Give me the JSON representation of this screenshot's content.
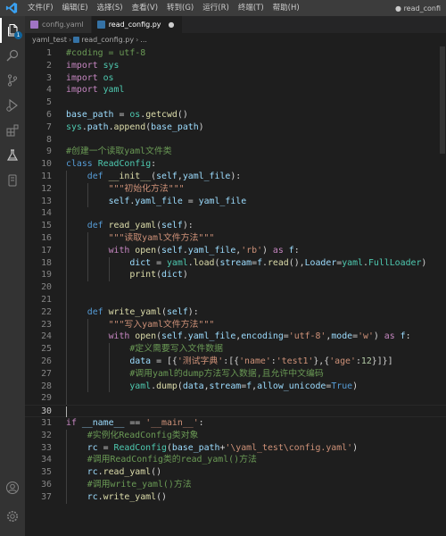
{
  "titlebar": {
    "menu": [
      "文件(F)",
      "编辑(E)",
      "选择(S)",
      "查看(V)",
      "转到(G)",
      "运行(R)",
      "终端(T)",
      "帮助(H)"
    ],
    "window_title": "● read_confi"
  },
  "activitybar": {
    "explorer_badge": "1",
    "icons": [
      "files-icon",
      "search-icon",
      "source-control-icon",
      "run-debug-icon",
      "extensions-icon",
      "flask-icon",
      "test-icon",
      "account-icon",
      "settings-icon"
    ]
  },
  "tabs": [
    {
      "label": "config.yaml",
      "icon": "yaml-file-icon",
      "active": false
    },
    {
      "label": "read_config.py",
      "icon": "python-file-icon",
      "active": true,
      "close": "●"
    }
  ],
  "breadcrumb": {
    "folder": "yaml_test",
    "sep": "›",
    "file": "read_config.py",
    "symbol": "..."
  },
  "editor": {
    "current_line": 30,
    "lines": [
      {
        "n": "1",
        "tokens": [
          {
            "t": "#coding = utf-8",
            "c": "cm"
          }
        ]
      },
      {
        "n": "2",
        "tokens": [
          {
            "t": "import",
            "c": "kw"
          },
          {
            "t": " sys",
            "c": "cls"
          }
        ]
      },
      {
        "n": "3",
        "tokens": [
          {
            "t": "import",
            "c": "kw"
          },
          {
            "t": " os",
            "c": "cls"
          }
        ]
      },
      {
        "n": "4",
        "tokens": [
          {
            "t": "import",
            "c": "kw"
          },
          {
            "t": " yaml",
            "c": "cls"
          }
        ]
      },
      {
        "n": "5",
        "tokens": []
      },
      {
        "n": "6",
        "tokens": [
          {
            "t": "base_path",
            "c": "var"
          },
          {
            "t": " = ",
            "c": "op"
          },
          {
            "t": "os",
            "c": "cls"
          },
          {
            "t": ".",
            "c": "op"
          },
          {
            "t": "getcwd",
            "c": "fn"
          },
          {
            "t": "()",
            "c": "op"
          }
        ]
      },
      {
        "n": "7",
        "tokens": [
          {
            "t": "sys",
            "c": "cls"
          },
          {
            "t": ".",
            "c": "op"
          },
          {
            "t": "path",
            "c": "var"
          },
          {
            "t": ".",
            "c": "op"
          },
          {
            "t": "append",
            "c": "fn"
          },
          {
            "t": "(",
            "c": "op"
          },
          {
            "t": "base_path",
            "c": "var"
          },
          {
            "t": ")",
            "c": "op"
          }
        ]
      },
      {
        "n": "8",
        "tokens": []
      },
      {
        "n": "9",
        "tokens": [
          {
            "t": "#创建一个读取yaml文件类",
            "c": "cm"
          }
        ]
      },
      {
        "n": "10",
        "tokens": [
          {
            "t": "class",
            "c": "kb"
          },
          {
            "t": " ",
            "c": "op"
          },
          {
            "t": "ReadConfig",
            "c": "cls"
          },
          {
            "t": ":",
            "c": "op"
          }
        ]
      },
      {
        "n": "11",
        "tokens": [
          {
            "t": "    ",
            "c": "op"
          },
          {
            "t": "def",
            "c": "kb"
          },
          {
            "t": " ",
            "c": "op"
          },
          {
            "t": "__init__",
            "c": "fn"
          },
          {
            "t": "(",
            "c": "op"
          },
          {
            "t": "self",
            "c": "var"
          },
          {
            "t": ",",
            "c": "op"
          },
          {
            "t": "yaml_file",
            "c": "var"
          },
          {
            "t": "):",
            "c": "op"
          }
        ]
      },
      {
        "n": "12",
        "tokens": [
          {
            "t": "        ",
            "c": "op"
          },
          {
            "t": "\"\"\"初始化方法\"\"\"",
            "c": "str"
          }
        ]
      },
      {
        "n": "13",
        "tokens": [
          {
            "t": "        ",
            "c": "op"
          },
          {
            "t": "self",
            "c": "var"
          },
          {
            "t": ".",
            "c": "op"
          },
          {
            "t": "yaml_file",
            "c": "var"
          },
          {
            "t": " = ",
            "c": "op"
          },
          {
            "t": "yaml_file",
            "c": "var"
          }
        ]
      },
      {
        "n": "14",
        "tokens": []
      },
      {
        "n": "15",
        "tokens": [
          {
            "t": "    ",
            "c": "op"
          },
          {
            "t": "def",
            "c": "kb"
          },
          {
            "t": " ",
            "c": "op"
          },
          {
            "t": "read_yaml",
            "c": "fn"
          },
          {
            "t": "(",
            "c": "op"
          },
          {
            "t": "self",
            "c": "var"
          },
          {
            "t": "):",
            "c": "op"
          }
        ]
      },
      {
        "n": "16",
        "tokens": [
          {
            "t": "        ",
            "c": "op"
          },
          {
            "t": "\"\"\"读取yaml文件方法\"\"\"",
            "c": "str"
          }
        ]
      },
      {
        "n": "17",
        "tokens": [
          {
            "t": "        ",
            "c": "op"
          },
          {
            "t": "with",
            "c": "kw"
          },
          {
            "t": " ",
            "c": "op"
          },
          {
            "t": "open",
            "c": "fn"
          },
          {
            "t": "(",
            "c": "op"
          },
          {
            "t": "self",
            "c": "var"
          },
          {
            "t": ".",
            "c": "op"
          },
          {
            "t": "yaml_file",
            "c": "var"
          },
          {
            "t": ",",
            "c": "op"
          },
          {
            "t": "'rb'",
            "c": "str"
          },
          {
            "t": ") ",
            "c": "op"
          },
          {
            "t": "as",
            "c": "kw"
          },
          {
            "t": " ",
            "c": "op"
          },
          {
            "t": "f",
            "c": "var"
          },
          {
            "t": ":",
            "c": "op"
          }
        ]
      },
      {
        "n": "18",
        "tokens": [
          {
            "t": "            ",
            "c": "op"
          },
          {
            "t": "dict",
            "c": "var"
          },
          {
            "t": " = ",
            "c": "op"
          },
          {
            "t": "yaml",
            "c": "cls"
          },
          {
            "t": ".",
            "c": "op"
          },
          {
            "t": "load",
            "c": "fn"
          },
          {
            "t": "(",
            "c": "op"
          },
          {
            "t": "stream",
            "c": "var"
          },
          {
            "t": "=",
            "c": "op"
          },
          {
            "t": "f",
            "c": "var"
          },
          {
            "t": ".",
            "c": "op"
          },
          {
            "t": "read",
            "c": "fn"
          },
          {
            "t": "(),",
            "c": "op"
          },
          {
            "t": "Loader",
            "c": "var"
          },
          {
            "t": "=",
            "c": "op"
          },
          {
            "t": "yaml",
            "c": "cls"
          },
          {
            "t": ".",
            "c": "op"
          },
          {
            "t": "FullLoader",
            "c": "cls"
          },
          {
            "t": ")",
            "c": "op"
          }
        ]
      },
      {
        "n": "19",
        "tokens": [
          {
            "t": "            ",
            "c": "op"
          },
          {
            "t": "print",
            "c": "fn"
          },
          {
            "t": "(",
            "c": "op"
          },
          {
            "t": "dict",
            "c": "var"
          },
          {
            "t": ")",
            "c": "op"
          }
        ]
      },
      {
        "n": "20",
        "tokens": []
      },
      {
        "n": "21",
        "tokens": []
      },
      {
        "n": "22",
        "tokens": [
          {
            "t": "    ",
            "c": "op"
          },
          {
            "t": "def",
            "c": "kb"
          },
          {
            "t": " ",
            "c": "op"
          },
          {
            "t": "write_yaml",
            "c": "fn"
          },
          {
            "t": "(",
            "c": "op"
          },
          {
            "t": "self",
            "c": "var"
          },
          {
            "t": "):",
            "c": "op"
          }
        ]
      },
      {
        "n": "23",
        "tokens": [
          {
            "t": "        ",
            "c": "op"
          },
          {
            "t": "\"\"\"写入yaml文件方法\"\"\"",
            "c": "str"
          }
        ]
      },
      {
        "n": "24",
        "tokens": [
          {
            "t": "        ",
            "c": "op"
          },
          {
            "t": "with",
            "c": "kw"
          },
          {
            "t": " ",
            "c": "op"
          },
          {
            "t": "open",
            "c": "fn"
          },
          {
            "t": "(",
            "c": "op"
          },
          {
            "t": "self",
            "c": "var"
          },
          {
            "t": ".",
            "c": "op"
          },
          {
            "t": "yaml_file",
            "c": "var"
          },
          {
            "t": ",",
            "c": "op"
          },
          {
            "t": "encoding",
            "c": "var"
          },
          {
            "t": "=",
            "c": "op"
          },
          {
            "t": "'utf-8'",
            "c": "str"
          },
          {
            "t": ",",
            "c": "op"
          },
          {
            "t": "mode",
            "c": "var"
          },
          {
            "t": "=",
            "c": "op"
          },
          {
            "t": "'w'",
            "c": "str"
          },
          {
            "t": ") ",
            "c": "op"
          },
          {
            "t": "as",
            "c": "kw"
          },
          {
            "t": " ",
            "c": "op"
          },
          {
            "t": "f",
            "c": "var"
          },
          {
            "t": ":",
            "c": "op"
          }
        ]
      },
      {
        "n": "25",
        "tokens": [
          {
            "t": "            ",
            "c": "op"
          },
          {
            "t": "#定义需要写入文件数据",
            "c": "cm"
          }
        ]
      },
      {
        "n": "26",
        "tokens": [
          {
            "t": "            ",
            "c": "op"
          },
          {
            "t": "data",
            "c": "var"
          },
          {
            "t": " = ",
            "c": "op"
          },
          {
            "t": "[{",
            "c": "op"
          },
          {
            "t": "'测试字典'",
            "c": "str"
          },
          {
            "t": ":[{",
            "c": "op"
          },
          {
            "t": "'name'",
            "c": "str"
          },
          {
            "t": ":",
            "c": "op"
          },
          {
            "t": "'test1'",
            "c": "str"
          },
          {
            "t": "},{",
            "c": "op"
          },
          {
            "t": "'age'",
            "c": "str"
          },
          {
            "t": ":",
            "c": "op"
          },
          {
            "t": "12",
            "c": "num"
          },
          {
            "t": "}]}]",
            "c": "op"
          }
        ]
      },
      {
        "n": "27",
        "tokens": [
          {
            "t": "            ",
            "c": "op"
          },
          {
            "t": "#调用yaml的dump方法写入数据,且允许中文编码",
            "c": "cm"
          }
        ]
      },
      {
        "n": "28",
        "tokens": [
          {
            "t": "            ",
            "c": "op"
          },
          {
            "t": "yaml",
            "c": "cls"
          },
          {
            "t": ".",
            "c": "op"
          },
          {
            "t": "dump",
            "c": "fn"
          },
          {
            "t": "(",
            "c": "op"
          },
          {
            "t": "data",
            "c": "var"
          },
          {
            "t": ",",
            "c": "op"
          },
          {
            "t": "stream",
            "c": "var"
          },
          {
            "t": "=",
            "c": "op"
          },
          {
            "t": "f",
            "c": "var"
          },
          {
            "t": ",",
            "c": "op"
          },
          {
            "t": "allow_unicode",
            "c": "var"
          },
          {
            "t": "=",
            "c": "op"
          },
          {
            "t": "True",
            "c": "kb"
          },
          {
            "t": ")",
            "c": "op"
          }
        ]
      },
      {
        "n": "29",
        "tokens": []
      },
      {
        "n": "30",
        "tokens": []
      },
      {
        "n": "31",
        "tokens": [
          {
            "t": "if",
            "c": "kw"
          },
          {
            "t": " ",
            "c": "op"
          },
          {
            "t": "__name__",
            "c": "var"
          },
          {
            "t": " == ",
            "c": "op"
          },
          {
            "t": "'__main__'",
            "c": "str"
          },
          {
            "t": ":",
            "c": "op"
          }
        ]
      },
      {
        "n": "32",
        "tokens": [
          {
            "t": "    ",
            "c": "op"
          },
          {
            "t": "#实例化ReadConfig类对象",
            "c": "cm"
          }
        ]
      },
      {
        "n": "33",
        "tokens": [
          {
            "t": "    ",
            "c": "op"
          },
          {
            "t": "rc",
            "c": "var"
          },
          {
            "t": " = ",
            "c": "op"
          },
          {
            "t": "ReadConfig",
            "c": "cls"
          },
          {
            "t": "(",
            "c": "op"
          },
          {
            "t": "base_path",
            "c": "var"
          },
          {
            "t": "+",
            "c": "op"
          },
          {
            "t": "'\\yaml_test\\config.yaml'",
            "c": "str"
          },
          {
            "t": ")",
            "c": "op"
          }
        ]
      },
      {
        "n": "34",
        "tokens": [
          {
            "t": "    ",
            "c": "op"
          },
          {
            "t": "#调用ReadConfig类的read_yaml()方法",
            "c": "cm"
          }
        ]
      },
      {
        "n": "35",
        "tokens": [
          {
            "t": "    ",
            "c": "op"
          },
          {
            "t": "rc",
            "c": "var"
          },
          {
            "t": ".",
            "c": "op"
          },
          {
            "t": "read_yaml",
            "c": "fn"
          },
          {
            "t": "()",
            "c": "op"
          }
        ]
      },
      {
        "n": "36",
        "tokens": [
          {
            "t": "    ",
            "c": "op"
          },
          {
            "t": "#调用write_yaml()方法",
            "c": "cm"
          }
        ]
      },
      {
        "n": "37",
        "tokens": [
          {
            "t": "    ",
            "c": "op"
          },
          {
            "t": "rc",
            "c": "var"
          },
          {
            "t": ".",
            "c": "op"
          },
          {
            "t": "write_yaml",
            "c": "fn"
          },
          {
            "t": "()",
            "c": "op"
          }
        ]
      }
    ]
  }
}
